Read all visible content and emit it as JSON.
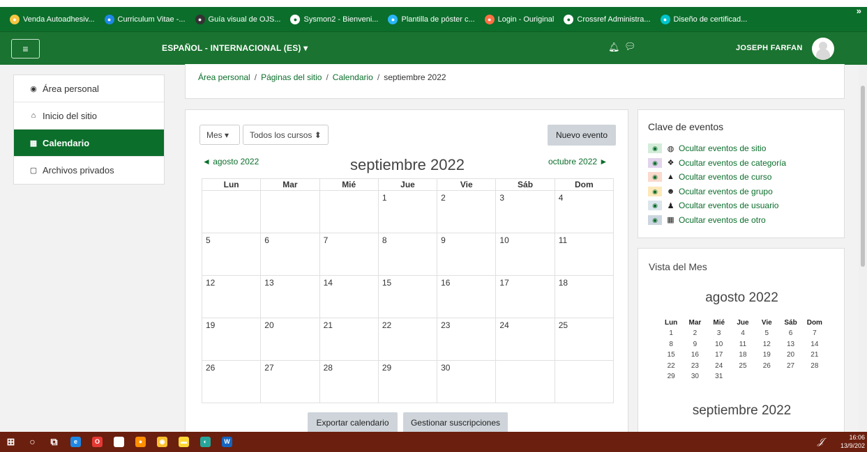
{
  "bookmarks": [
    {
      "label": "Venda Autoadhesiv...",
      "icon": "bookmark-icon",
      "color": "#f5c542"
    },
    {
      "label": "Curriculum Vitae -...",
      "icon": "cv-icon",
      "color": "#1e88e5"
    },
    {
      "label": "Guía visual de OJS...",
      "icon": "ojs-icon",
      "color": "#333333"
    },
    {
      "label": "Sysmon2 - Bienveni...",
      "icon": "globe-icon",
      "color": "#ffffff"
    },
    {
      "label": "Plantilla de póster c...",
      "icon": "poster-icon",
      "color": "#29b6f6"
    },
    {
      "label": "Login - Ouriginal",
      "icon": "ouriginal-icon",
      "color": "#ff7043"
    },
    {
      "label": "Crossref Administra...",
      "icon": "globe-icon",
      "color": "#ffffff"
    },
    {
      "label": "Diseño de certificad...",
      "icon": "canva-icon",
      "color": "#00c4cc"
    }
  ],
  "bookmarks_more": "»",
  "navbar": {
    "language": "ESPAÑOL - INTERNACIONAL (ES) ▾",
    "user_name": "JOSEPH FARFAN"
  },
  "sidebar": {
    "items": [
      {
        "label": "Área personal",
        "icon": "dashboard-icon",
        "active": false
      },
      {
        "label": "Inicio del sitio",
        "icon": "home-icon",
        "active": false
      },
      {
        "label": "Calendario",
        "icon": "calendar-icon",
        "active": true
      },
      {
        "label": "Archivos privados",
        "icon": "file-icon",
        "active": false
      }
    ]
  },
  "breadcrumb": {
    "items": [
      "Área personal",
      "Páginas del sitio",
      "Calendario"
    ],
    "current": "septiembre 2022",
    "separator": "/"
  },
  "calendar": {
    "view_select": "Mes ▾",
    "course_select": "Todos los cursos ⬍",
    "new_event": "Nuevo evento",
    "prev_month": "◄  agosto 2022",
    "next_month": "octubre 2022  ►",
    "title": "septiembre 2022",
    "weekdays": [
      "Lun",
      "Mar",
      "Mié",
      "Jue",
      "Vie",
      "Sáb",
      "Dom"
    ],
    "weeks": [
      [
        "",
        "",
        "",
        "1",
        "2",
        "3",
        "4"
      ],
      [
        "5",
        "6",
        "7",
        "8",
        "9",
        "10",
        "11"
      ],
      [
        "12",
        "13",
        "14",
        "15",
        "16",
        "17",
        "18"
      ],
      [
        "19",
        "20",
        "21",
        "22",
        "23",
        "24",
        "25"
      ],
      [
        "26",
        "27",
        "28",
        "29",
        "30",
        "",
        ""
      ]
    ],
    "export_button": "Exportar calendario",
    "subscriptions_button": "Gestionar suscripciones"
  },
  "event_key": {
    "title": "Clave de eventos",
    "rows": [
      {
        "label": "Ocultar eventos de sitio",
        "icon": "globe-icon",
        "swatch": "#d4edda"
      },
      {
        "label": "Ocultar eventos de categoría",
        "icon": "cubes-icon",
        "swatch": "#e2d4ec"
      },
      {
        "label": "Ocultar eventos de curso",
        "icon": "graduation-cap-icon",
        "swatch": "#fbd9cc"
      },
      {
        "label": "Ocultar eventos de grupo",
        "icon": "group-icon",
        "swatch": "#fde8b9"
      },
      {
        "label": "Ocultar eventos de usuario",
        "icon": "user-icon",
        "swatch": "#dce5ec"
      },
      {
        "label": "Ocultar eventos de otro",
        "icon": "calendar-icon",
        "swatch": "#ccd6e0"
      }
    ]
  },
  "month_view": {
    "title": "Vista del Mes",
    "mini1_title": "agosto 2022",
    "mini_weekdays": [
      "Lun",
      "Mar",
      "Mié",
      "Jue",
      "Vie",
      "Sáb",
      "Dom"
    ],
    "mini1_weeks": [
      [
        "1",
        "2",
        "3",
        "4",
        "5",
        "6",
        "7"
      ],
      [
        "8",
        "9",
        "10",
        "11",
        "12",
        "13",
        "14"
      ],
      [
        "15",
        "16",
        "17",
        "18",
        "19",
        "20",
        "21"
      ],
      [
        "22",
        "23",
        "24",
        "25",
        "26",
        "27",
        "28"
      ],
      [
        "29",
        "30",
        "31",
        "",
        "",
        "",
        ""
      ]
    ],
    "mini2_title": "septiembre 2022"
  },
  "taskbar": {
    "apps": [
      {
        "name": "windows-start-icon",
        "glyph": "⊞",
        "color": "#ffffff"
      },
      {
        "name": "search-icon",
        "glyph": "○",
        "color": "#ffffff"
      },
      {
        "name": "task-view-icon",
        "glyph": "⧉",
        "color": "#ffffff"
      },
      {
        "name": "edge-icon",
        "glyph": "e",
        "color": "#1e88e5"
      },
      {
        "name": "opera-icon",
        "glyph": "O",
        "color": "#e53935"
      },
      {
        "name": "store-icon",
        "glyph": "▣",
        "color": "#ffffff"
      },
      {
        "name": "firefox-icon",
        "glyph": "●",
        "color": "#ff8f00"
      },
      {
        "name": "chrome-icon",
        "glyph": "◉",
        "color": "#fbc02d"
      },
      {
        "name": "file-explorer-icon",
        "glyph": "▬",
        "color": "#fdd835"
      },
      {
        "name": "chrome-alt-icon",
        "glyph": "◐",
        "color": "#26a69a"
      },
      {
        "name": "word-icon",
        "glyph": "W",
        "color": "#1565c0"
      }
    ],
    "time": "16:06",
    "date": "13/9/202"
  }
}
